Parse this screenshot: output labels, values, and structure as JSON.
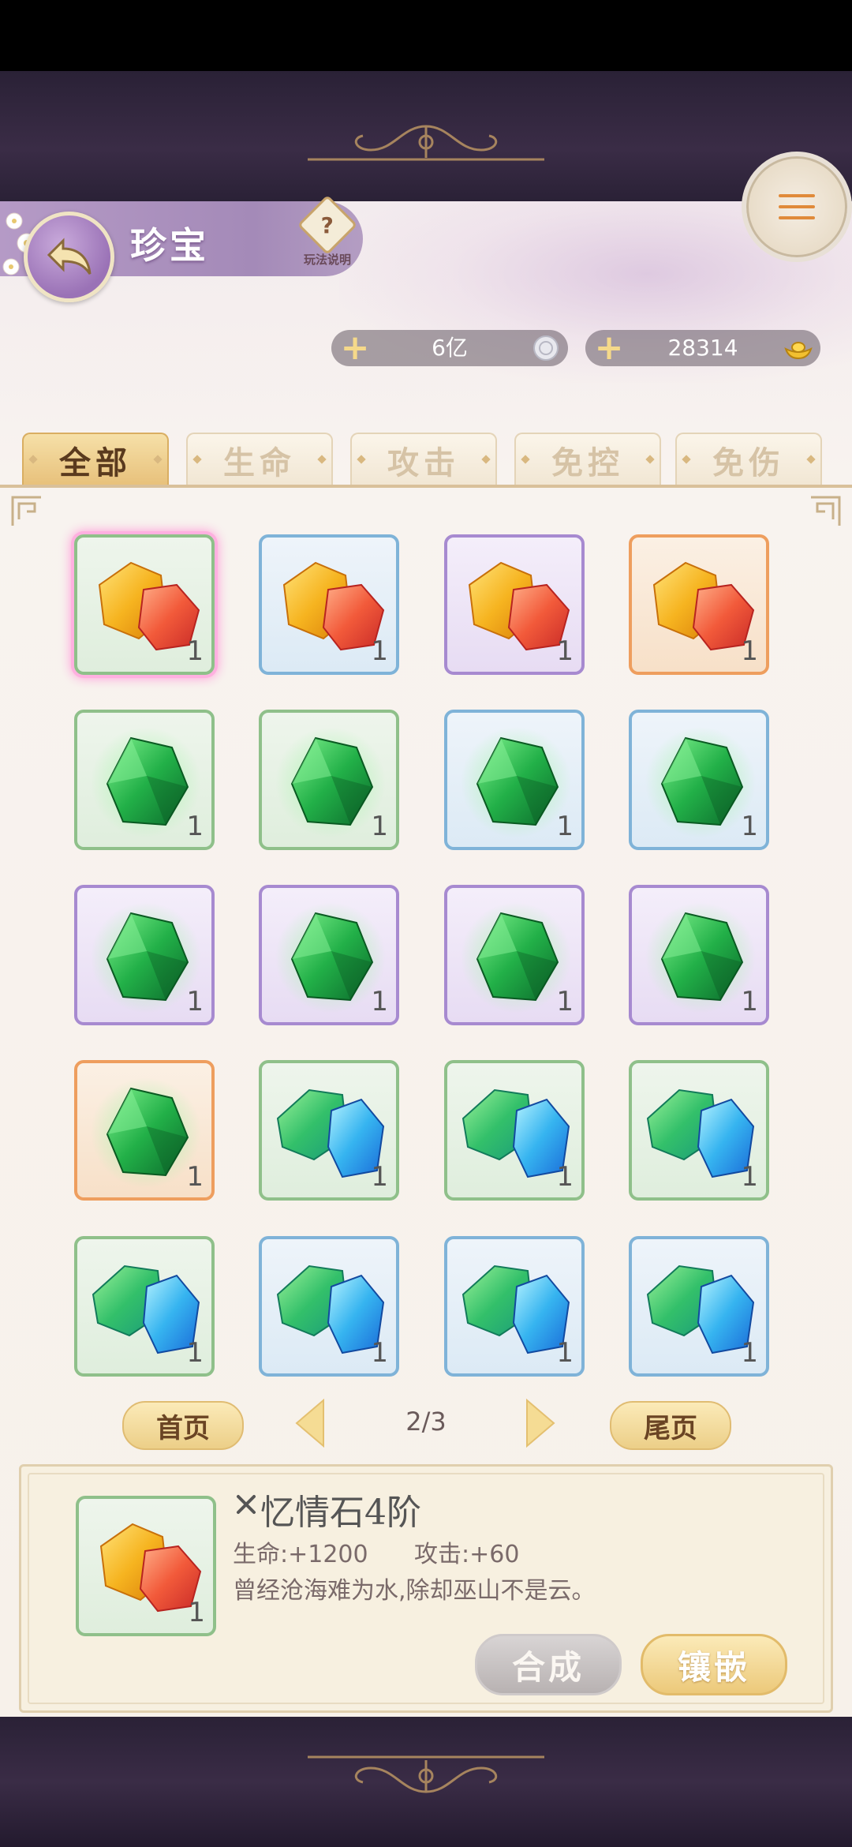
{
  "header": {
    "title": "珍宝",
    "help_label": "玩法说明",
    "help_symbol": "?"
  },
  "currencies": [
    {
      "value": "6亿",
      "icon": "silver-coin-icon"
    },
    {
      "value": "28314",
      "icon": "gold-ingot-icon"
    }
  ],
  "tabs": [
    "全部",
    "生命",
    "攻击",
    "免控",
    "免伤"
  ],
  "active_tab": "全部",
  "grid": [
    {
      "gem": "amber",
      "quality": "green",
      "count": "1",
      "selected": true
    },
    {
      "gem": "amber",
      "quality": "blue",
      "count": "1"
    },
    {
      "gem": "amber",
      "quality": "purple",
      "count": "1"
    },
    {
      "gem": "amber",
      "quality": "orange",
      "count": "1"
    },
    {
      "gem": "emerald",
      "quality": "green",
      "count": "1"
    },
    {
      "gem": "emerald",
      "quality": "green",
      "count": "1"
    },
    {
      "gem": "emerald",
      "quality": "blue",
      "count": "1"
    },
    {
      "gem": "emerald",
      "quality": "blue",
      "count": "1"
    },
    {
      "gem": "emerald",
      "quality": "purple",
      "count": "1"
    },
    {
      "gem": "emerald",
      "quality": "purple",
      "count": "1"
    },
    {
      "gem": "emerald",
      "quality": "purple",
      "count": "1"
    },
    {
      "gem": "emerald",
      "quality": "purple",
      "count": "1"
    },
    {
      "gem": "emerald",
      "quality": "orange",
      "count": "1"
    },
    {
      "gem": "aqua",
      "quality": "green",
      "count": "1"
    },
    {
      "gem": "aqua",
      "quality": "green",
      "count": "1"
    },
    {
      "gem": "aqua",
      "quality": "green",
      "count": "1"
    },
    {
      "gem": "aqua",
      "quality": "green",
      "count": "1"
    },
    {
      "gem": "aqua",
      "quality": "blue",
      "count": "1"
    },
    {
      "gem": "aqua",
      "quality": "blue",
      "count": "1"
    },
    {
      "gem": "aqua",
      "quality": "blue",
      "count": "1"
    }
  ],
  "pager": {
    "first_label": "首页",
    "last_label": "尾页",
    "indicator": "2/3"
  },
  "detail": {
    "name": "忆情石4阶",
    "count": "1",
    "stat_hp": "生命:+1200",
    "stat_atk": "攻击:+60",
    "description": "曾经沧海难为水,除却巫山不是云。",
    "synth_label": "合成",
    "inlay_label": "镶嵌"
  },
  "colors": {
    "quality_green": "#8fc08a",
    "quality_blue": "#7fb3d8",
    "quality_purple": "#a78ad0",
    "quality_orange": "#ee9e5e",
    "accent_gold": "#eccf88",
    "banner_purple": "#a48ab8"
  }
}
